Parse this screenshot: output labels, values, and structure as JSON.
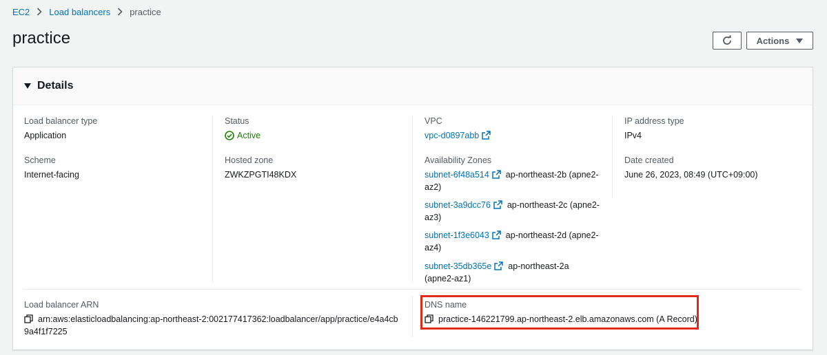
{
  "breadcrumb": {
    "items": [
      "EC2",
      "Load balancers"
    ],
    "current": "practice"
  },
  "page": {
    "title": "practice"
  },
  "toolbar": {
    "actions_label": "Actions"
  },
  "details": {
    "header": "Details",
    "load_balancer_type": {
      "label": "Load balancer type",
      "value": "Application"
    },
    "scheme": {
      "label": "Scheme",
      "value": "Internet-facing"
    },
    "status": {
      "label": "Status",
      "value": "Active"
    },
    "hosted_zone": {
      "label": "Hosted zone",
      "value": "ZWKZPGTI48KDX"
    },
    "vpc": {
      "label": "VPC",
      "value": "vpc-d0897abb"
    },
    "availability_zones": {
      "label": "Availability Zones",
      "items": [
        {
          "subnet": "subnet-6f48a514",
          "zone_line1": "ap-northeast-2b (apne2-",
          "zone_line2": "az2)"
        },
        {
          "subnet": "subnet-3a9dcc76",
          "zone_line1": "ap-northeast-2c (apne2-",
          "zone_line2": "az3)"
        },
        {
          "subnet": "subnet-1f3e6043",
          "zone_line1": "ap-northeast-2d (apne2-",
          "zone_line2": "az4)"
        },
        {
          "subnet": "subnet-35db365e",
          "zone_line1": "ap-northeast-2a",
          "zone_line2": "(apne2-az1)"
        }
      ]
    },
    "ip_address_type": {
      "label": "IP address type",
      "value": "IPv4"
    },
    "date_created": {
      "label": "Date created",
      "value": "June 26, 2023, 08:49 (UTC+09:00)"
    },
    "arn": {
      "label": "Load balancer ARN",
      "value_line1": "arn:aws:elasticloadbalancing:ap-northeast-2:002177417362:loadbalancer/app/practice/e4a4cb",
      "value_line2": "9a4f1f7225"
    },
    "dns_name": {
      "label": "DNS name",
      "value": "practice-146221799.ap-northeast-2.elb.amazonaws.com (A Record)"
    }
  },
  "colors": {
    "link": "#0073bb",
    "status_active": "#1d8102",
    "highlight": "#e12b1a"
  }
}
